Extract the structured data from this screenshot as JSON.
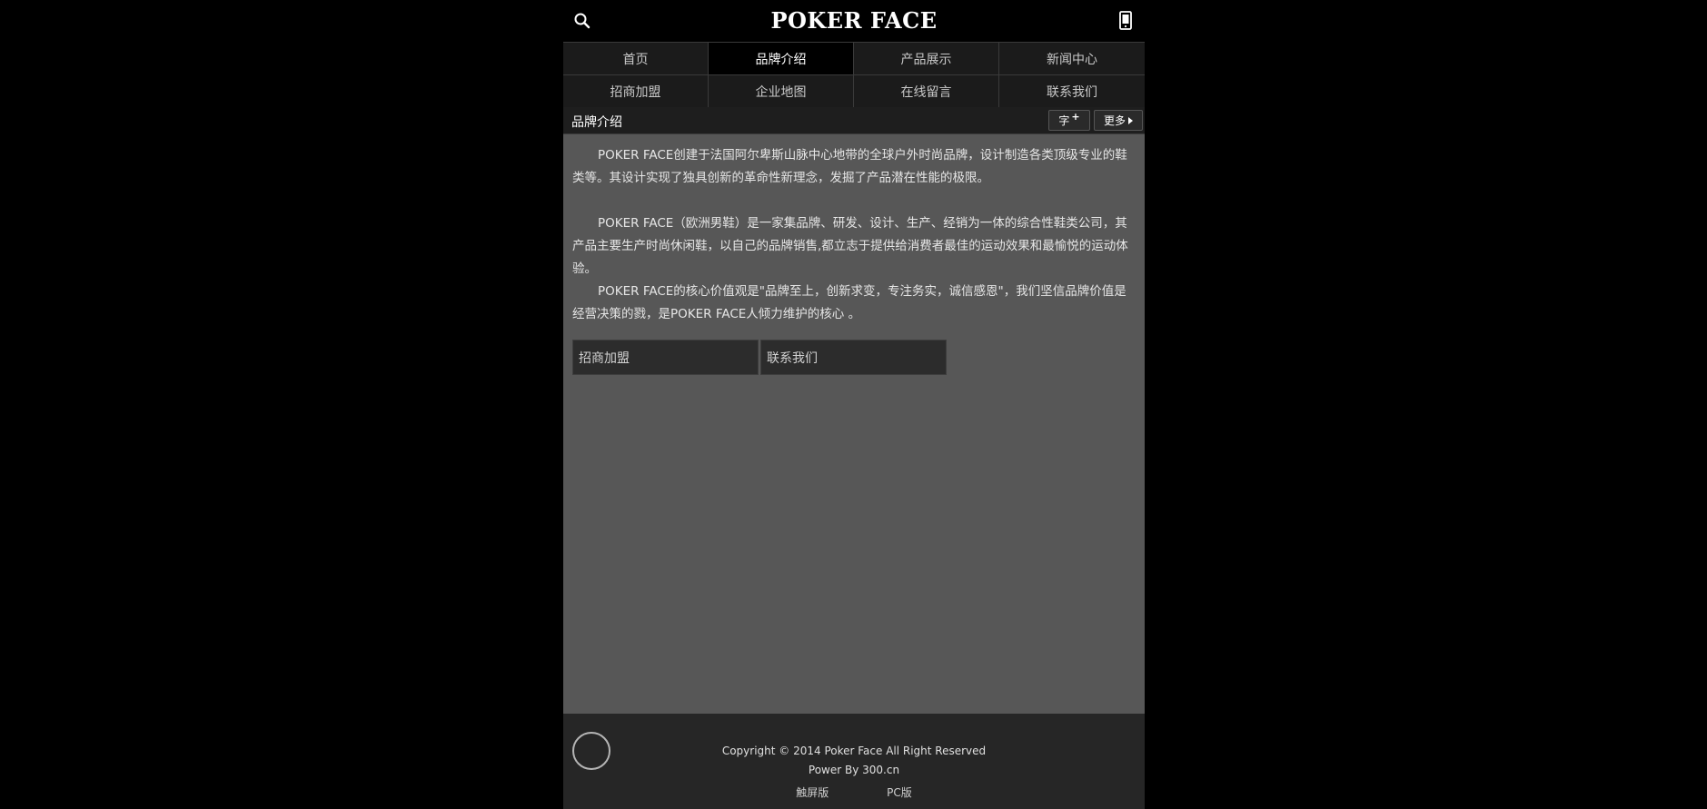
{
  "header": {
    "logo": "POKER FACE",
    "search_icon": "search-icon",
    "mobile_icon": "mobile-phone-icon"
  },
  "nav": {
    "items": [
      {
        "label": "首页",
        "active": false
      },
      {
        "label": "品牌介绍",
        "active": true
      },
      {
        "label": "产品展示",
        "active": false
      },
      {
        "label": "新闻中心",
        "active": false
      },
      {
        "label": "招商加盟",
        "active": false
      },
      {
        "label": "企业地图",
        "active": false
      },
      {
        "label": "在线留言",
        "active": false
      },
      {
        "label": "联系我们",
        "active": false
      }
    ]
  },
  "titlebar": {
    "title": "品牌介绍",
    "font_label": "字",
    "font_plus": "+",
    "more_label": "更多"
  },
  "content": {
    "p1": "POKER FACE创建于法国阿尔卑斯山脉中心地带的全球户外时尚品牌，设计制造各类顶级专业的鞋类等。其设计实现了独具创新的革命性新理念，发掘了产品潜在性能的极限。",
    "p2": "POKER FACE（欧洲男鞋）是一家集品牌、研发、设计、生产、经销为一体的综合性鞋类公司，其产品主要生产时尚休闲鞋，以自己的品牌销售,都立志于提供给消费者最佳的运动效果和最愉悦的运动体验。",
    "p3": "POKER FACE的核心价值观是\"品牌至上，创新求变，专注务实，诚信感恩\"，我们坚信品牌价值是经营决策的戮，是POKER FACE人倾力维护的核心 。",
    "links": [
      "招商加盟",
      "联系我们"
    ]
  },
  "footer": {
    "copyright": "Copyright © 2014 Poker Face All Right Reserved",
    "power": "Power By 300.cn",
    "touch_label": "触屏版",
    "pc_label": "PC版"
  },
  "colors": {
    "page_bg": "#000000",
    "nav_bg": "#1b1b1b",
    "content_bg": "#575757",
    "footer_bg": "#262626"
  }
}
